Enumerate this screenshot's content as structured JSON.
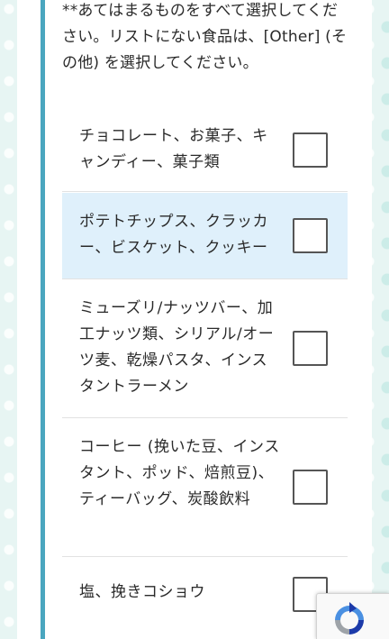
{
  "question": {
    "instruction": "**あてはまるものをすべて選択してください。リストにない食品は、[Other] (その他) を選択してください。"
  },
  "options": [
    {
      "label": "チョコレート、お菓子、キャンディー、菓子類",
      "checked": false,
      "highlighted": false
    },
    {
      "label": "ポテトチップス、クラッカー、ビスケット、クッキー",
      "checked": false,
      "highlighted": true
    },
    {
      "label": "ミューズリ/ナッツバー、加工ナッツ類、シリアル/オーツ麦、乾燥パスタ、インスタントラーメン",
      "checked": false,
      "highlighted": false
    },
    {
      "label": "コーヒー (挽いた豆、インスタント、ポッド、焙煎豆)、ティーバッグ、炭酸飲料",
      "checked": false,
      "highlighted": false
    },
    {
      "label": "塩、挽きコショウ",
      "checked": false,
      "highlighted": false
    }
  ],
  "colors": {
    "accent_bar": "#4aa6bf",
    "highlight_row": "#dff0fb",
    "page_background": "#e7f5f3"
  },
  "recaptcha": {
    "icon": "recaptcha-logo-icon"
  }
}
